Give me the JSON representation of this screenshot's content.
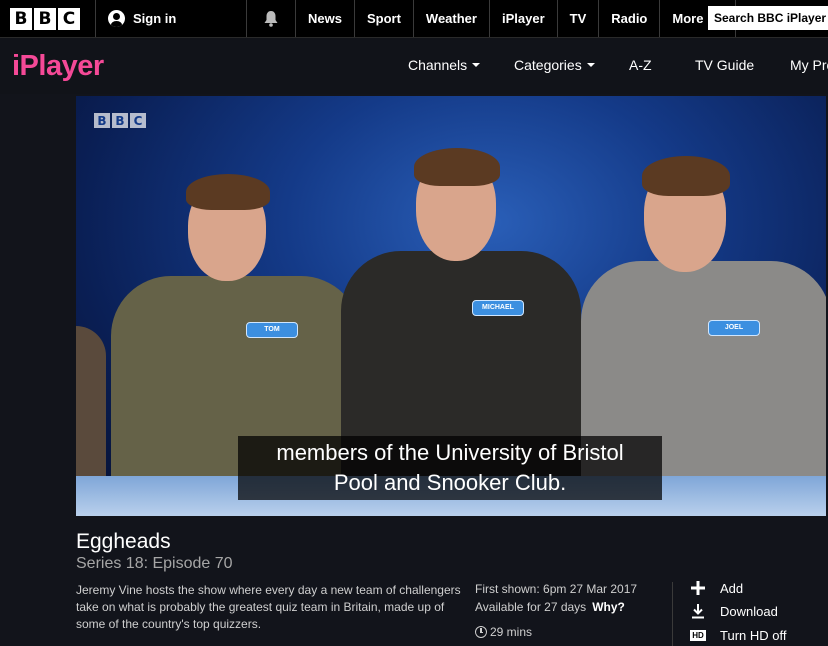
{
  "bbc_bar": {
    "logo_letters": [
      "B",
      "B",
      "C"
    ],
    "signin_label": "Sign in",
    "nav_items": [
      "News",
      "Sport",
      "Weather",
      "iPlayer",
      "TV",
      "Radio"
    ],
    "more_label": "More",
    "search_placeholder": "Search BBC iPlayer"
  },
  "iplayer_header": {
    "logo_text": "iPlayer",
    "nav": [
      "Channels",
      "Categories",
      "A-Z",
      "TV Guide",
      "My Pro"
    ]
  },
  "player": {
    "watermark_letters": [
      "B",
      "B",
      "C"
    ],
    "subtitle_lines": [
      "members of the University of Bristol",
      "Pool and Snooker Club."
    ],
    "badges": [
      "TOM",
      "MICHAEL",
      "JOEL"
    ]
  },
  "programme": {
    "title": "Eggheads",
    "series": "Series 18: Episode 70",
    "description": "Jeremy Vine hosts the show where every day a new team of challengers take on what is probably the greatest quiz team in Britain, made up of some of the country's top quizzers.",
    "first_shown": "First shown: 6pm 27 Mar 2017",
    "available": "Available for 27 days",
    "why_label": "Why?",
    "duration": "29 mins"
  },
  "actions": {
    "add": "Add",
    "download": "Download",
    "hd": "Turn HD off",
    "hd_icon_text": "HD"
  },
  "colors": {
    "iplayer_pink": "#f54997",
    "header_bg": "#111319",
    "page_bg": "#12141b"
  }
}
